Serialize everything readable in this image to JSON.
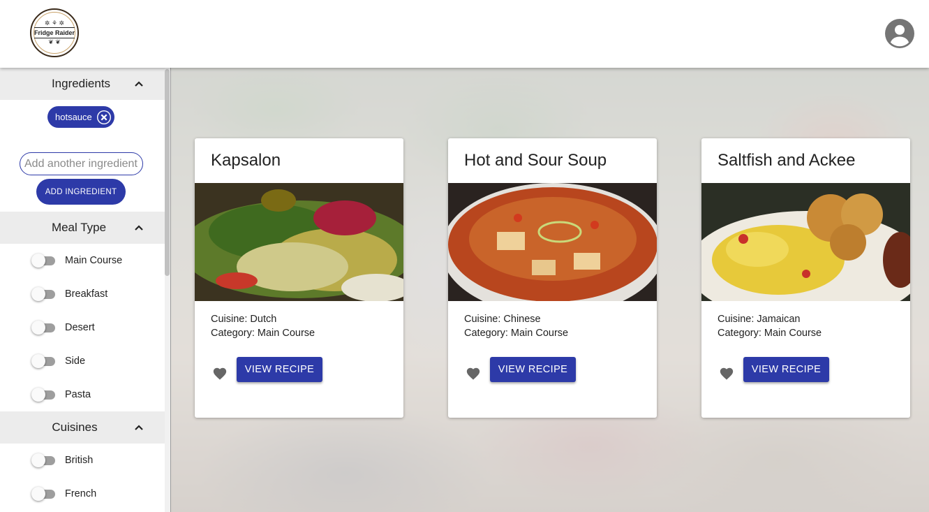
{
  "header": {
    "logo": {
      "text": "Fridge Raider"
    },
    "avatar_icon": "account-circle-icon"
  },
  "sidebar": {
    "ingredients": {
      "title": "Ingredients",
      "chips": [
        "hotsauce"
      ],
      "input_placeholder": "Add another ingredient...",
      "add_button": "ADD INGREDIENT"
    },
    "meal_type": {
      "title": "Meal Type",
      "options": [
        "Main Course",
        "Breakfast",
        "Desert",
        "Side",
        "Pasta"
      ]
    },
    "cuisines": {
      "title": "Cuisines",
      "options": [
        "British",
        "French"
      ]
    }
  },
  "recipes": [
    {
      "title": "Kapsalon",
      "cuisine": "Cuisine: Dutch",
      "category": "Category: Main Course",
      "button": "VIEW RECIPE"
    },
    {
      "title": "Hot and Sour Soup",
      "cuisine": "Cuisine: Chinese",
      "category": "Category: Main Course",
      "button": "VIEW RECIPE"
    },
    {
      "title": "Saltfish and Ackee",
      "cuisine": "Cuisine: Jamaican",
      "category": "Category: Main Course",
      "button": "VIEW RECIPE"
    }
  ],
  "colors": {
    "primary": "#2d3aa8",
    "section_bg": "#ececec",
    "heart": "#666666"
  }
}
